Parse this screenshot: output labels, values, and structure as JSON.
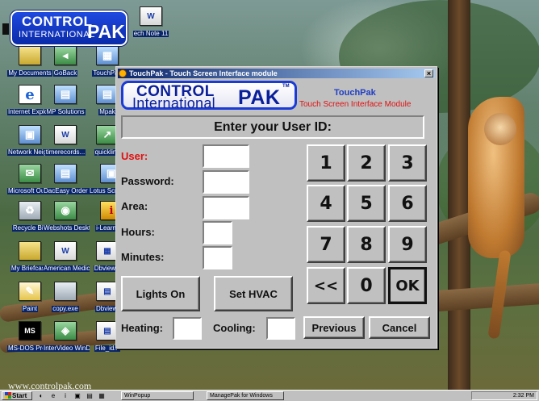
{
  "desktop": {
    "badge": {
      "line1": "CONTROL",
      "line2": "INTERNATIONAL",
      "line3": "PAK"
    },
    "watermark": "www.controlpak.com",
    "icons": [
      {
        "name": "icon-my-documents",
        "label": "My Documents",
        "glyph": "",
        "kind": "folder"
      },
      {
        "name": "icon-goback",
        "label": "GoBack",
        "glyph": "◂",
        "kind": "app"
      },
      {
        "name": "icon-touchpak",
        "label": "TouchPak",
        "glyph": "▦",
        "kind": "pc"
      },
      {
        "name": "icon-tech-note",
        "label": "ech Note 11",
        "glyph": "W",
        "kind": "doc"
      },
      {
        "name": "icon-internet-explorer",
        "label": "Internet Explorer",
        "glyph": "e",
        "kind": "ie"
      },
      {
        "name": "icon-mp-solutions",
        "label": "MP Solutions",
        "glyph": "▤",
        "kind": "pc"
      },
      {
        "name": "icon-mpak",
        "label": "Mpak",
        "glyph": "▤",
        "kind": "pc"
      },
      {
        "name": "icon-network-neighborhood",
        "label": "Network Neighborhood",
        "glyph": "▣",
        "kind": "pc"
      },
      {
        "name": "icon-timerecords",
        "label": "timerecords...",
        "glyph": "W",
        "kind": "doc"
      },
      {
        "name": "icon-quicklink",
        "label": "quicklink",
        "glyph": "↗",
        "kind": "app"
      },
      {
        "name": "icon-microsoft-outlook",
        "label": "Microsoft Outlook",
        "glyph": "✉",
        "kind": "app"
      },
      {
        "name": "icon-daceasy",
        "label": "DacEasy Order Entry ...",
        "glyph": "▤",
        "kind": "pc"
      },
      {
        "name": "icon-lotus-screencam",
        "label": "Lotus ScreenCa",
        "glyph": "▣",
        "kind": "pc"
      },
      {
        "name": "icon-recycle-bin",
        "label": "Recycle Bin",
        "glyph": "♻",
        "kind": "bin"
      },
      {
        "name": "icon-webshots",
        "label": "Webshots Desktop!",
        "glyph": "◉",
        "kind": "app"
      },
      {
        "name": "icon-ilearn",
        "label": "i-Learn My",
        "glyph": "i",
        "kind": "red"
      },
      {
        "name": "icon-my-briefcase",
        "label": "My Briefcase",
        "glyph": "",
        "kind": "folder"
      },
      {
        "name": "icon-american-medical",
        "label": "American Medical Rei...",
        "glyph": "W",
        "kind": "doc"
      },
      {
        "name": "icon-dbview",
        "label": "Dbview.e",
        "glyph": "▦",
        "kind": "doc"
      },
      {
        "name": "icon-paint",
        "label": "Paint",
        "glyph": "✎",
        "kind": "paint"
      },
      {
        "name": "icon-copy-exe",
        "label": "copy.exe",
        "glyph": "",
        "kind": "bin"
      },
      {
        "name": "icon-dbview-2",
        "label": "Dbview.",
        "glyph": "▤",
        "kind": "doc"
      },
      {
        "name": "icon-ms-dos-prompt",
        "label": "MS-DOS Prompt",
        "glyph": "MS",
        "kind": "dos"
      },
      {
        "name": "icon-intervideo-windvd",
        "label": "InterVideo WinDVD",
        "glyph": "◈",
        "kind": "app"
      },
      {
        "name": "icon-file-id",
        "label": "File_id.d",
        "glyph": "▤",
        "kind": "doc"
      }
    ]
  },
  "window": {
    "title": "TouchPak - Touch Screen Interface module",
    "close_glyph": "×",
    "logo": {
      "line1": "CONTROL",
      "line2": "International",
      "line3": "PAK",
      "tm": "TM"
    },
    "product_name": "TouchPak",
    "product_subtitle": "Touch Screen Interface Module",
    "prompt": "Enter your User ID:",
    "fields": {
      "user": {
        "label": "User:",
        "value": ""
      },
      "password": {
        "label": "Password:",
        "value": ""
      },
      "area": {
        "label": "Area:",
        "value": ""
      },
      "hours": {
        "label": "Hours:",
        "value": ""
      },
      "minutes": {
        "label": "Minutes:",
        "value": ""
      },
      "heating": {
        "label": "Heating:",
        "value": ""
      },
      "cooling": {
        "label": "Cooling:",
        "value": ""
      }
    },
    "keypad": [
      "1",
      "2",
      "3",
      "4",
      "5",
      "6",
      "7",
      "8",
      "9",
      "<<",
      "0",
      "OK"
    ],
    "buttons": {
      "lights_on": "Lights On",
      "set_hvac": "Set HVAC",
      "previous": "Previous",
      "cancel": "Cancel"
    }
  },
  "taskbar": {
    "start": "Start",
    "quicklaunch": [
      "◐",
      "e",
      "i",
      "▣",
      "▤",
      "▦"
    ],
    "tasks": [
      "WinPopup",
      "ManagePak for Windows"
    ],
    "time": "2:32 PM"
  }
}
